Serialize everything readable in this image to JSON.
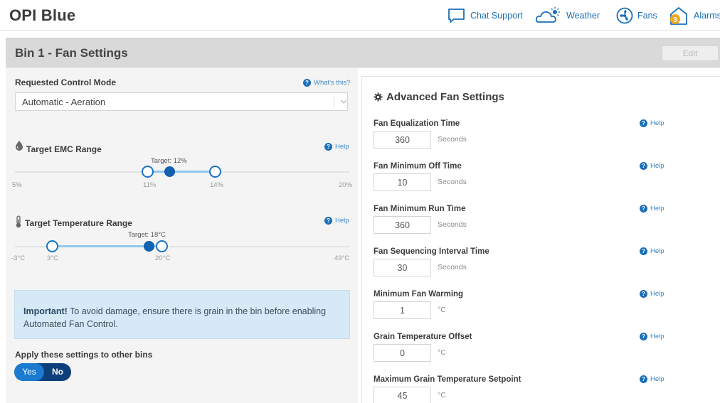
{
  "app": {
    "title": "OPI Blue"
  },
  "nav": {
    "chat_support": "Chat Support",
    "weather": "Weather",
    "fans": "Fans",
    "alarms": "Alarms",
    "alarms_badge": "3"
  },
  "section": {
    "title": "Bin 1 - Fan Settings",
    "edit_label": "Edit"
  },
  "control_mode": {
    "label": "Requested Control Mode",
    "whats_this": "What's this?",
    "value": "Automatic - Aeration"
  },
  "emc": {
    "label": "Target EMC Range",
    "help": "Help",
    "target_label": "Target: 12%",
    "min_label": "5%",
    "max_label": "20%",
    "low_label": "11%",
    "high_label": "14%",
    "range": {
      "min": 5,
      "max": 20,
      "low": 11,
      "high": 14,
      "target": 12
    }
  },
  "temperature": {
    "label": "Target Temperature Range",
    "help": "Help",
    "target_label": "Target: 18°C",
    "min_label": "-3°C",
    "max_label": "49°C",
    "low_label": "3°C",
    "high_label": "20°C",
    "range": {
      "min": -3,
      "max": 49,
      "low": 3,
      "high": 20,
      "target": 18
    }
  },
  "important": {
    "bold": "Important!",
    "text": " To avoid damage, ensure there is grain in the bin before enabling Automated Fan Control."
  },
  "apply": {
    "label": "Apply these settings to other bins",
    "yes": "Yes",
    "no": "No"
  },
  "advanced": {
    "title": "Advanced Fan Settings",
    "fields": [
      {
        "label": "Fan Equalization Time",
        "value": "360",
        "unit": "Seconds",
        "help": "Help"
      },
      {
        "label": "Fan Minimum Off Time",
        "value": "10",
        "unit": "Seconds",
        "help": "Help"
      },
      {
        "label": "Fan Minimum Run Time",
        "value": "360",
        "unit": "Seconds",
        "help": "Help"
      },
      {
        "label": "Fan Sequencing Interval Time",
        "value": "30",
        "unit": "Seconds",
        "help": "Help"
      },
      {
        "label": "Minimum Fan Warming",
        "value": "1",
        "unit": "°C",
        "help": "Help"
      },
      {
        "label": "Grain Temperature Offset",
        "value": "0",
        "unit": "°C",
        "help": "Help"
      },
      {
        "label": "Maximum Grain Temperature Setpoint",
        "value": "45",
        "unit": "°C",
        "help": "Help"
      }
    ]
  },
  "colors": {
    "accent": "#1a6fb8",
    "toggle_dark": "#0d3f7a",
    "important_bg": "#d6e9f6"
  }
}
